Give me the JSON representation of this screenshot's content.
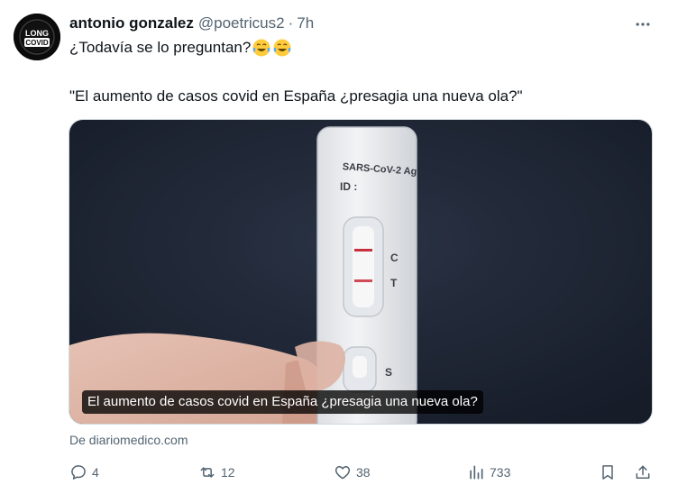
{
  "tweet": {
    "author_name": "antonio gonzalez",
    "author_handle": "@poetricus2",
    "separator": "·",
    "time": "7h",
    "avatar_text_top": "LONG",
    "avatar_text_bottom": "COVID",
    "text_line1": "¿Todavía se lo preguntan?",
    "emojis": [
      "face-with-tears-of-joy",
      "face-with-tears-of-joy"
    ],
    "text_line2": "\"El aumento de casos covid en España ¿presagia una nueva ola?\""
  },
  "card": {
    "image_caption": "El aumento de casos covid en España ¿presagia una nueva ola?",
    "image_description_text": {
      "test_label": "SARS-CoV-2 Ag",
      "id_label": "ID :",
      "c_label": "C",
      "t_label": "T",
      "s_label": "S"
    },
    "source": "De diariomedico.com"
  },
  "actions": {
    "replies": "4",
    "retweets": "12",
    "likes": "38",
    "views": "733"
  },
  "colors": {
    "text_primary": "#0f1419",
    "text_secondary": "#536471",
    "border": "#cfd9de"
  }
}
